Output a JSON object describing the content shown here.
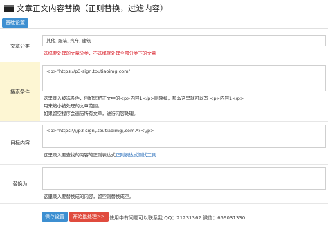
{
  "header": {
    "title": "文章正文内容替换（正则替换，过滤内容）"
  },
  "tabs": [
    {
      "label": "基础设置"
    }
  ],
  "form": {
    "category": {
      "label": "文章分类",
      "value": "其他, 服装, 汽车, 建筑",
      "hint": "选择要处理的文章分类，不选择就处理全部分类下的文章"
    },
    "search": {
      "label": "搜索条件",
      "value": "<p>\"https://p3-sign.toutiaoimg.com/",
      "hint_line1": "这里录入被选条件，例如您把正文中的<p>内容1</p>删除掉，那么这里就可以写 <p>内容1</p>",
      "hint_line2": "用来缩小被处理的文章范围。",
      "hint_line3": "如果留空程序会遍历所有文章，进行内容处理。"
    },
    "target": {
      "label": "目标内容",
      "value": "<p>\"https:\\/\\/p3-sign\\.toutiaoimg\\.com.*?<\\/p>",
      "hint_prefix": "这里录入要查找的内容的正则表达式",
      "hint_link": "正则表达式测试工具"
    },
    "replace": {
      "label": "替换为",
      "value": "",
      "hint": "这里录入要替换成的内容，留空则替换成空。"
    }
  },
  "actions": {
    "save_label": "保存设置",
    "run_label": "开始批处理>>",
    "footnote": "使用中有问题可以联系我 QQ：21231362 微信：659031330"
  }
}
